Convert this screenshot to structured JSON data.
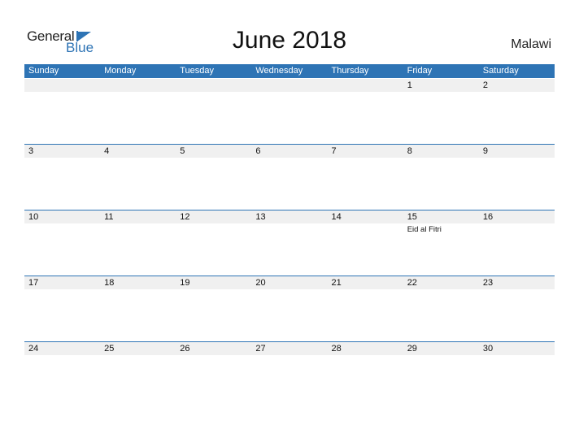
{
  "logo": {
    "part1": "General",
    "part2": "Blue"
  },
  "title": "June 2018",
  "country": "Malawi",
  "weekdays": [
    "Sunday",
    "Monday",
    "Tuesday",
    "Wednesday",
    "Thursday",
    "Friday",
    "Saturday"
  ],
  "weeks": [
    [
      "",
      "",
      "",
      "",
      "",
      "1",
      "2"
    ],
    [
      "3",
      "4",
      "5",
      "6",
      "7",
      "8",
      "9"
    ],
    [
      "10",
      "11",
      "12",
      "13",
      "14",
      "15",
      "16"
    ],
    [
      "17",
      "18",
      "19",
      "20",
      "21",
      "22",
      "23"
    ],
    [
      "24",
      "25",
      "26",
      "27",
      "28",
      "29",
      "30"
    ]
  ],
  "events": {
    "15": "Eid al Fitri"
  },
  "colors": {
    "accent": "#2e74b5",
    "strip": "#f0f0f0"
  }
}
